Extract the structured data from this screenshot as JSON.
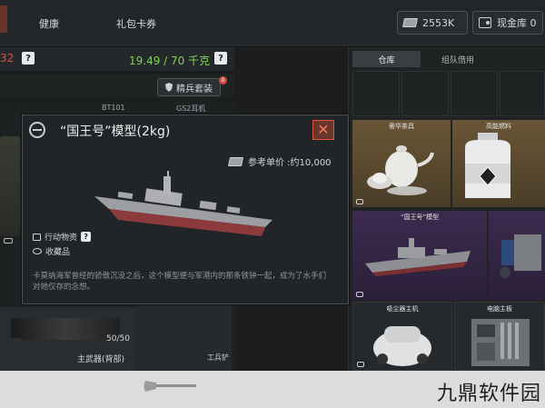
{
  "nav": {
    "tab_health": "健康",
    "tab_gift": "礼包卡券"
  },
  "currency": {
    "cash": "2553K",
    "cash_vault": "现金库 0"
  },
  "status": {
    "left_value": "32",
    "weight": "19.49 / 70 千克",
    "help": "?"
  },
  "loadout": {
    "elite_suit": "精兵套装",
    "badge_count": "0",
    "slot_1": "BT101",
    "slot_2": "GS2耳机",
    "ammo": "50/50",
    "primary_weapon": "主武器(背部)",
    "shovel": "工兵铲"
  },
  "storage": {
    "tab_warehouse": "仓库",
    "tab_team_loan": "组队借用",
    "items": [
      {
        "label": "奢华茶具"
      },
      {
        "label": "高能燃料"
      },
      {
        "label": "“国王号”模型"
      },
      {
        "label": ""
      },
      {
        "label": "吸尘器主机"
      },
      {
        "label": "电脑主板"
      }
    ]
  },
  "modal": {
    "title": "“国王号”模型(2kg)",
    "close": "✕",
    "price": "参考单价 :约10,000",
    "tag_action": "行动物资",
    "tag_help": "?",
    "tag_collectible": "收藏品",
    "description": "卡莫纳海军曾经的骄傲沉没之后，这个模型便与军港内的那条铁钟一起，成为了水手们对她仅存的念想。"
  },
  "watermark": "九鼎软件园",
  "colors": {
    "accent_red": "#e24a3b",
    "weight_green": "#7fd34f",
    "rare_gold": "#5b4a2f",
    "rare_purple": "#3f2c52"
  }
}
